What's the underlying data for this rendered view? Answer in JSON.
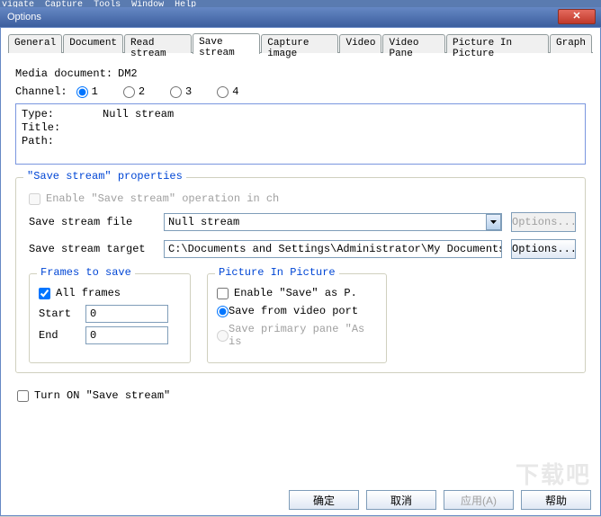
{
  "menu": {
    "items": [
      "vigate",
      "Capture",
      "Tools",
      "Window",
      "Help"
    ]
  },
  "window": {
    "title": "Options"
  },
  "tabs": {
    "items": [
      {
        "label": "General"
      },
      {
        "label": "Document"
      },
      {
        "label": "Read stream"
      },
      {
        "label": "Save stream",
        "active": true
      },
      {
        "label": "Capture image"
      },
      {
        "label": "Video"
      },
      {
        "label": "Video Pane"
      },
      {
        "label": "Picture In Picture"
      },
      {
        "label": "Graph"
      }
    ]
  },
  "media": {
    "label": "Media document:",
    "value": "DM2"
  },
  "channel": {
    "label": "Channel:",
    "options": [
      "1",
      "2",
      "3",
      "4"
    ],
    "selected": "1"
  },
  "info": {
    "type_label": "Type:",
    "type_value": "Null stream",
    "title_label": "Title:",
    "title_value": "",
    "path_label": "Path:",
    "path_value": ""
  },
  "props": {
    "legend": "\"Save stream\" properties",
    "enable": {
      "label": "Enable \"Save stream\" operation in ch",
      "checked": false
    },
    "file": {
      "label": "Save stream file",
      "value": "Null stream",
      "options_btn": "Options..."
    },
    "target": {
      "label": "Save stream target",
      "value": "C:\\Documents and Settings\\Administrator\\My Documents\\M",
      "options_btn": "Options..."
    }
  },
  "frames": {
    "legend": "Frames to save",
    "all": {
      "label": "All frames",
      "checked": true
    },
    "start": {
      "label": "Start",
      "value": "0"
    },
    "end": {
      "label": "End",
      "value": "0"
    }
  },
  "pip": {
    "legend": "Picture In Picture",
    "enable": {
      "label": "Enable \"Save\" as P.",
      "checked": false
    },
    "save_from": {
      "label": "Save from video port",
      "checked": true
    },
    "save_primary": {
      "label": "Save primary pane \"As is"
    }
  },
  "turn_on": {
    "label": "Turn  ON \"Save stream\"",
    "checked": false
  },
  "footer": {
    "ok": "确定",
    "cancel": "取消",
    "apply": "应用(A)",
    "help": "帮助"
  },
  "watermark": "下载吧"
}
